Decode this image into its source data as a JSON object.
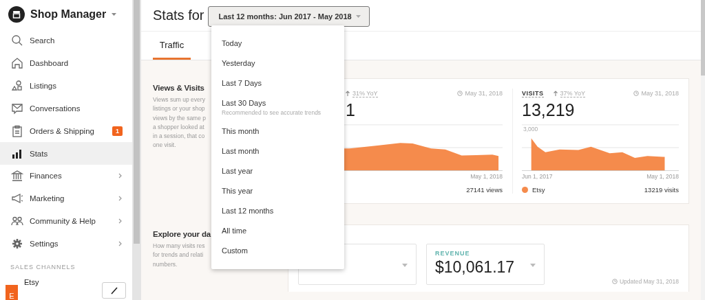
{
  "sidebar": {
    "title": "Shop Manager",
    "items": [
      {
        "label": "Search",
        "selected": false,
        "expandable": false
      },
      {
        "label": "Dashboard",
        "selected": false,
        "expandable": false
      },
      {
        "label": "Listings",
        "selected": false,
        "expandable": false
      },
      {
        "label": "Conversations",
        "selected": false,
        "expandable": false
      },
      {
        "label": "Orders & Shipping",
        "selected": false,
        "expandable": false,
        "badge": "1"
      },
      {
        "label": "Stats",
        "selected": true,
        "expandable": false
      },
      {
        "label": "Finances",
        "selected": false,
        "expandable": true
      },
      {
        "label": "Marketing",
        "selected": false,
        "expandable": true
      },
      {
        "label": "Community & Help",
        "selected": false,
        "expandable": true
      },
      {
        "label": "Settings",
        "selected": false,
        "expandable": true
      }
    ],
    "section_label": "SALES CHANNELS",
    "channels": [
      {
        "initial": "E",
        "label": "Etsy"
      }
    ]
  },
  "header": {
    "title": "Stats for",
    "range_button": "Last 12 months: Jun 2017 - May 2018"
  },
  "tabs": [
    {
      "label": "Traffic",
      "selected": true
    }
  ],
  "range_menu": {
    "items": [
      {
        "label": "Today",
        "selected": false
      },
      {
        "label": "Yesterday",
        "selected": false
      },
      {
        "label": "Last 7 Days",
        "selected": false
      },
      {
        "label": "Last 30 Days",
        "selected": false,
        "hint": "Recommended to see accurate trends"
      },
      {
        "label": "This month",
        "selected": false
      },
      {
        "label": "Last month",
        "selected": false
      },
      {
        "label": "Last year",
        "selected": false
      },
      {
        "label": "This year",
        "selected": false
      },
      {
        "label": "Last 12 months",
        "selected": false
      },
      {
        "label": "All time",
        "selected": false
      },
      {
        "label": "Custom",
        "selected": false
      }
    ]
  },
  "views_visits": {
    "title": "Views & Visits",
    "description": "Views sum up every\nlistings or your shop\nviews by the same p\na shopper looked at\nin a session, that co\none visit.",
    "views": {
      "change": "31% YoY",
      "date": "May 31, 2018",
      "total": "1",
      "end_label": "May 1, 2018",
      "footer": "27141 views"
    },
    "visits": {
      "label": "VISITS",
      "change": "37% YoY",
      "date": "May 31, 2018",
      "total": "13,219",
      "y_label": "3,000",
      "start_label": "Jun 1, 2017",
      "end_label": "May 1, 2018",
      "legend": {
        "label": "Etsy",
        "color": "#f58b4c"
      },
      "footer": "13219 visits"
    }
  },
  "explore": {
    "title": "Explore your da",
    "description": "How many visits res\nfor trends and relati\nnumbers.",
    "metrics": [
      {
        "label": "REVENUE",
        "value": "$10,061.17"
      }
    ],
    "updated": "Updated May 31, 2018"
  }
}
